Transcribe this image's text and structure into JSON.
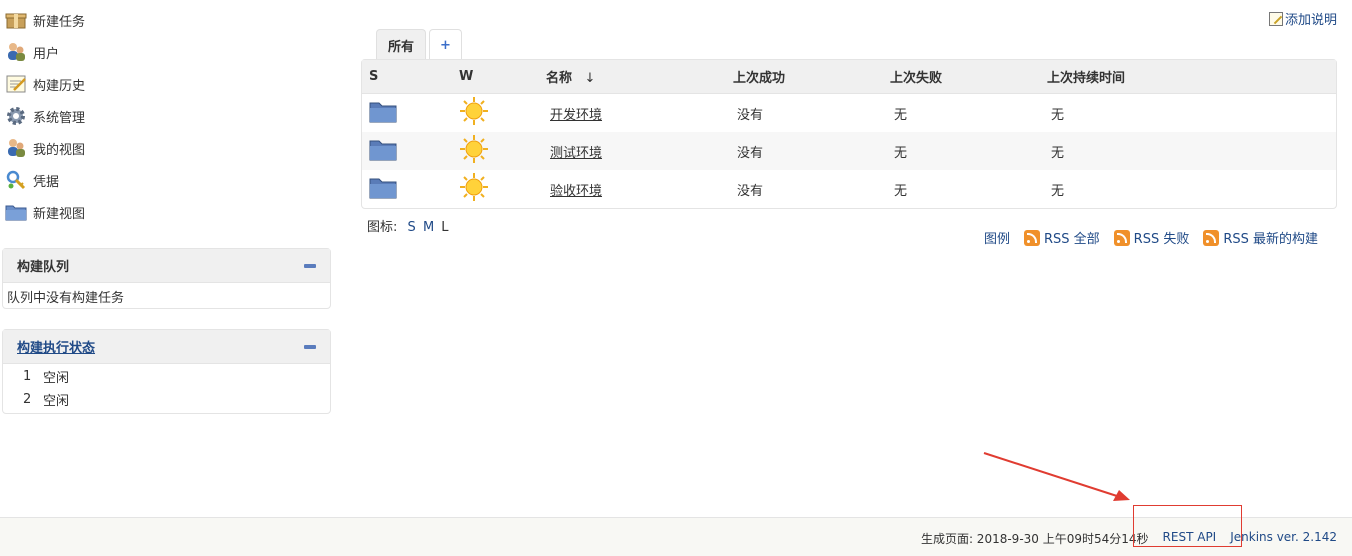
{
  "sidebar": {
    "tasks": [
      {
        "label": "新建任务",
        "icon": "new-item-icon"
      },
      {
        "label": "用户",
        "icon": "users-icon"
      },
      {
        "label": "构建历史",
        "icon": "build-history-icon"
      },
      {
        "label": "系统管理",
        "icon": "gear-icon"
      },
      {
        "label": "我的视图",
        "icon": "users-icon"
      },
      {
        "label": "凭据",
        "icon": "credentials-icon"
      },
      {
        "label": "新建视图",
        "icon": "folder-icon"
      }
    ],
    "queue": {
      "title": "构建队列",
      "empty_text": "队列中没有构建任务"
    },
    "executors": {
      "title": "构建执行状态",
      "rows": [
        {
          "num": "1",
          "status": "空闲"
        },
        {
          "num": "2",
          "status": "空闲"
        }
      ]
    }
  },
  "add_description": "添加说明",
  "tabs": [
    {
      "label": "所有",
      "active": true
    },
    {
      "label": "+",
      "active": false
    }
  ],
  "table": {
    "headers": {
      "s": "S",
      "w": "W",
      "name": "名称",
      "sort_indicator": "↓",
      "last_success": "上次成功",
      "last_failure": "上次失败",
      "last_duration": "上次持续时间"
    },
    "rows": [
      {
        "status_icon": "folder-icon",
        "weather_icon": "sunny-icon",
        "name": "开发环境",
        "last_success": "没有",
        "last_failure": "无",
        "last_duration": "无"
      },
      {
        "status_icon": "folder-icon",
        "weather_icon": "sunny-icon",
        "name": "测试环境",
        "last_success": "没有",
        "last_failure": "无",
        "last_duration": "无"
      },
      {
        "status_icon": "folder-icon",
        "weather_icon": "sunny-icon",
        "name": "验收环境",
        "last_success": "没有",
        "last_failure": "无",
        "last_duration": "无"
      }
    ]
  },
  "icon_size": {
    "label": "图标:",
    "options": [
      "S",
      "M",
      "L"
    ],
    "selected": "L"
  },
  "rss": {
    "legend": "图例",
    "all": "RSS 全部",
    "failed": "RSS 失败",
    "latest": "RSS 最新的构建"
  },
  "footer": {
    "generated": "生成页面: 2018-9-30 上午09时54分14秒",
    "rest_api": "REST API",
    "version": "Jenkins ver. 2.142"
  },
  "colors": {
    "link": "#204a87",
    "annotation": "#e03c31",
    "rss": "#f0902a"
  }
}
